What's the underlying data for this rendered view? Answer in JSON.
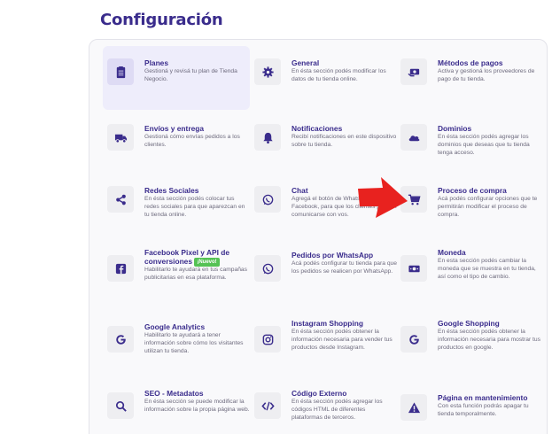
{
  "page": {
    "title": "Configuración"
  },
  "colors": {
    "accent": "#3a2c8c",
    "arrow": "#e8221f",
    "badge": "#54c254"
  },
  "cards": [
    {
      "id": "planes",
      "icon": "clipboard-icon",
      "title": "Planes",
      "desc": "Gestioná y revisá tu plan de Tienda Negocio."
    },
    {
      "id": "general",
      "icon": "gear-icon",
      "title": "General",
      "desc": "En ésta sección podés modificar los datos de tu tienda online."
    },
    {
      "id": "metodos-de-pago",
      "icon": "money-hand-icon",
      "title": "Métodos de pagos",
      "desc": "Activa y gestioná los proveedores de pago de tu tienda."
    },
    {
      "id": "envios",
      "icon": "truck-icon",
      "title": "Envíos y entrega",
      "desc": "Gestioná cómo envías pedidos a los clientes."
    },
    {
      "id": "notificaciones",
      "icon": "bell-icon",
      "title": "Notificaciones",
      "desc": "Recibí notificaciones en este dispositivo sobre tu tienda."
    },
    {
      "id": "dominios",
      "icon": "cloud-icon",
      "title": "Dominios",
      "desc": "En ésta sección podés agregar los dominios que deseas que tu tienda tenga acceso."
    },
    {
      "id": "redes-sociales",
      "icon": "share-icon",
      "title": "Redes Sociales",
      "desc": "En ésta sección podés colocar tus redes sociales para que aparezcan en tu tienda online."
    },
    {
      "id": "chat",
      "icon": "whatsapp-icon",
      "title": "Chat",
      "desc": "Agregá el botón de WhatsApp o Facebook, para que los clientes puedan comunicarse con vos."
    },
    {
      "id": "proceso-de-compra",
      "icon": "cart-icon",
      "title": "Proceso de compra",
      "desc": "Acá podés configurar opciones que te permitirán modificar el proceso de compra."
    },
    {
      "id": "facebook-pixel",
      "icon": "facebook-icon",
      "title": "Facebook Pixel y API de conversiones",
      "badge": "¡Nuevo!",
      "desc": "Habilitarlo te ayudará en tus campañas publicitarias en esa plataforma."
    },
    {
      "id": "pedidos-whatsapp",
      "icon": "whatsapp-icon",
      "title": "Pedidos por WhatsApp",
      "desc": "Acá podés configurar tu tienda para que los pedidos se realicen por WhatsApp."
    },
    {
      "id": "moneda",
      "icon": "banknote-icon",
      "title": "Moneda",
      "desc": "En esta sección podés cambiar la moneda que se muestra en tu tienda, así como el tipo de cambio."
    },
    {
      "id": "google-analytics",
      "icon": "google-icon",
      "title": "Google Analytics",
      "desc": "Habilitarlo te ayudará a tener información sobre cómo los visitantes utilizan tu tienda."
    },
    {
      "id": "instagram-shopping",
      "icon": "instagram-icon",
      "title": "Instagram Shopping",
      "desc": "En ésta sección podés obtener la información necesaria para vender tus productos desde Instagram."
    },
    {
      "id": "google-shopping",
      "icon": "google-icon",
      "title": "Google Shopping",
      "desc": "En ésta sección podés obtener la información necesaria para mostrar tus productos en google."
    },
    {
      "id": "seo",
      "icon": "search-icon",
      "title": "SEO - Metadatos",
      "desc": "En ésta sección se puede modificar la información sobre la propia página web."
    },
    {
      "id": "codigo-externo",
      "icon": "code-icon",
      "title": "Código Externo",
      "desc": "En ésta sección podés agregar los códigos HTML de diferentes plataformas de terceros."
    },
    {
      "id": "pagina-mantenimiento",
      "icon": "warning-icon",
      "title": "Página en mantenimiento",
      "desc": "Con esta función podrás apagar tu tienda temporalmente."
    }
  ]
}
